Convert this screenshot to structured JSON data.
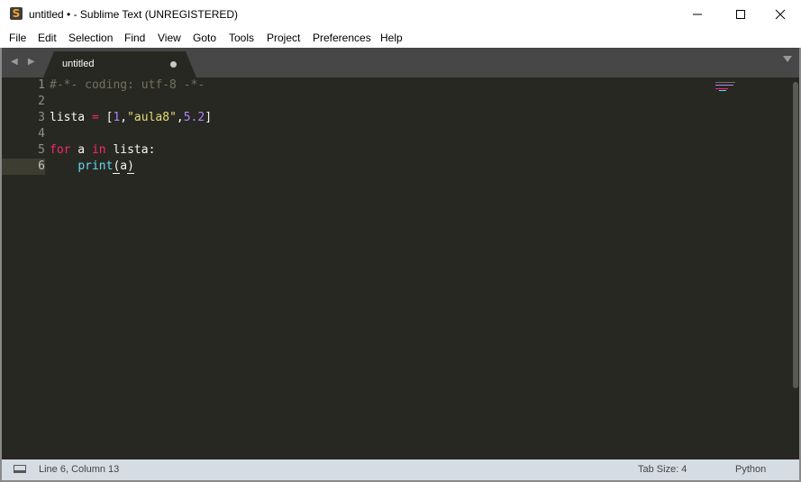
{
  "window": {
    "title": "untitled • - Sublime Text (UNREGISTERED)",
    "icon": "sublime-text-icon",
    "icon_glyph": "S",
    "minimize_glyph": "—",
    "maximize_glyph": "☐",
    "close_glyph": "✕"
  },
  "menu": {
    "items": [
      "File",
      "Edit",
      "Selection",
      "Find",
      "View",
      "Goto",
      "Tools",
      "Project",
      "Preferences",
      "Help"
    ]
  },
  "tabs": {
    "nav_glyph": "◀ ▶",
    "items": [
      {
        "label": "untitled",
        "dirty": true
      }
    ]
  },
  "editor": {
    "line_numbers": [
      "1",
      "2",
      "3",
      "4",
      "5",
      "6"
    ],
    "current_line": 6,
    "lines": [
      {
        "tokens": [
          {
            "t": "#-*- coding: utf-8 -*-",
            "c": "comment"
          }
        ]
      },
      {
        "tokens": []
      },
      {
        "tokens": [
          {
            "t": "lista ",
            "c": "plain"
          },
          {
            "t": "=",
            "c": "op"
          },
          {
            "t": " [",
            "c": "plain"
          },
          {
            "t": "1",
            "c": "num"
          },
          {
            "t": ",",
            "c": "plain"
          },
          {
            "t": "\"aula8\"",
            "c": "str"
          },
          {
            "t": ",",
            "c": "plain"
          },
          {
            "t": "5.2",
            "c": "num"
          },
          {
            "t": "]",
            "c": "plain"
          }
        ]
      },
      {
        "tokens": []
      },
      {
        "tokens": [
          {
            "t": "for",
            "c": "kw"
          },
          {
            "t": " a ",
            "c": "plain"
          },
          {
            "t": "in",
            "c": "kw"
          },
          {
            "t": " lista:",
            "c": "plain"
          }
        ]
      },
      {
        "tokens": [
          {
            "t": "    ",
            "c": "plain"
          },
          {
            "t": "print",
            "c": "fn"
          },
          {
            "t": "(",
            "c": "paren"
          },
          {
            "t": "a",
            "c": "plain"
          },
          {
            "t": ")",
            "c": "paren"
          }
        ]
      }
    ],
    "colors": {
      "background": "#272822",
      "comment": "#75715e",
      "keyword": "#f92672",
      "number": "#ae81ff",
      "string": "#e6db74",
      "function": "#66d9ef",
      "foreground": "#f8f8f2"
    }
  },
  "status": {
    "position": "Line 6, Column 13",
    "tab_size": "Tab Size: 4",
    "syntax": "Python"
  }
}
